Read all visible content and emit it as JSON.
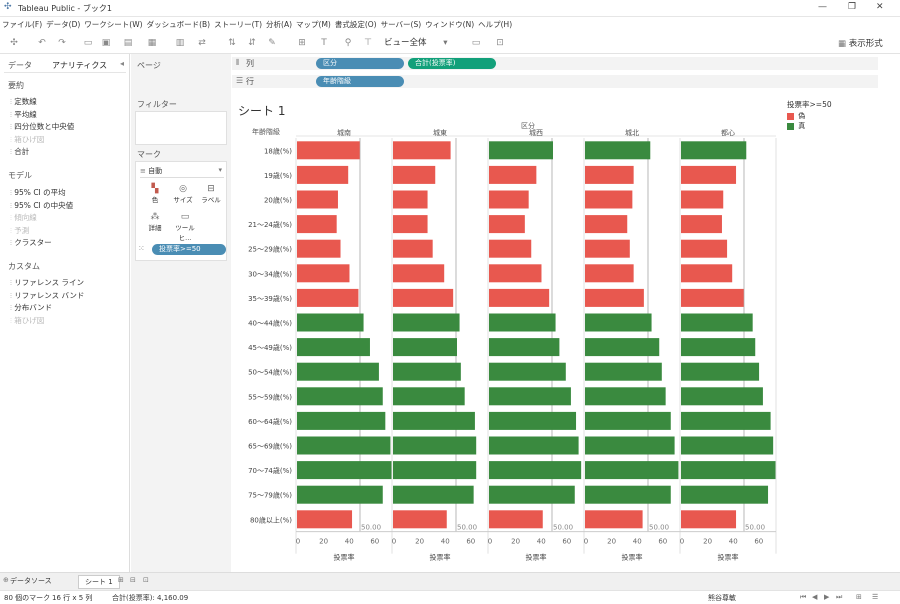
{
  "window": {
    "title": "Tableau Public - ブック1",
    "controls": [
      "—",
      "❐",
      "✕"
    ]
  },
  "menu": [
    "ファイル(F)",
    "データ(D)",
    "ワークシート(W)",
    "ダッシュボード(B)",
    "ストーリー(T)",
    "分析(A)",
    "マップ(M)",
    "書式設定(O)",
    "サーバー(S)",
    "ウィンドウ(N)",
    "ヘルプ(H)"
  ],
  "toolbar": {
    "view_fit": "ビュー全体",
    "show_me": "表示形式"
  },
  "left_panel": {
    "tab_data": "データ",
    "tab_analytics": "アナリティクス",
    "summary_title": "要約",
    "summary_items": [
      {
        "label": "定数線",
        "enabled": true
      },
      {
        "label": "平均線",
        "enabled": true
      },
      {
        "label": "四分位数と中央値",
        "enabled": true
      },
      {
        "label": "箱ひげ図",
        "enabled": false
      },
      {
        "label": "合計",
        "enabled": true
      }
    ],
    "model_title": "モデル",
    "model_items": [
      {
        "label": "95% CI の平均",
        "enabled": true
      },
      {
        "label": "95% CI の中央値",
        "enabled": true
      },
      {
        "label": "傾向線",
        "enabled": false
      },
      {
        "label": "予測",
        "enabled": false
      },
      {
        "label": "クラスター",
        "enabled": true
      }
    ],
    "custom_title": "カスタム",
    "custom_items": [
      {
        "label": "リファレンス ライン",
        "enabled": true
      },
      {
        "label": "リファレンス バンド",
        "enabled": true
      },
      {
        "label": "分布バンド",
        "enabled": true
      },
      {
        "label": "箱ひげ図",
        "enabled": false
      }
    ]
  },
  "mid_panel": {
    "pages": "ページ",
    "filters": "フィルター",
    "marks": "マーク",
    "mark_type": "自動",
    "buttons": [
      "色",
      "サイズ",
      "ラベル",
      "詳細",
      "ツールヒ..."
    ],
    "color_pill": "投票率>=50"
  },
  "shelves": {
    "columns_label": "列",
    "rows_label": "行",
    "columns_pills": [
      "区分",
      "合計(投票率)"
    ],
    "rows_pills": [
      "年齢階級"
    ]
  },
  "sheet_title": "シート 1",
  "legend": {
    "title": "投票率>=50",
    "items": [
      {
        "label": "偽",
        "color": "#e8584f"
      },
      {
        "label": "真",
        "color": "#3a8a3f"
      }
    ]
  },
  "chart_data": {
    "type": "bar",
    "orientation": "horizontal",
    "row_header": "年齢階級",
    "column_header": "区分",
    "panels": [
      "城南",
      "城東",
      "城西",
      "城北",
      "都心"
    ],
    "categories": [
      "18歳(%)",
      "19歳(%)",
      "20歳(%)",
      "21〜24歳(%)",
      "25〜29歳(%)",
      "30〜34歳(%)",
      "35〜39歳(%)",
      "40〜44歳(%)",
      "45〜49歳(%)",
      "50〜54歳(%)",
      "55〜59歳(%)",
      "60〜64歳(%)",
      "65〜69歳(%)",
      "70〜74歳(%)",
      "75〜79歳(%)",
      "80歳以上(%)"
    ],
    "series": [
      {
        "name": "城南",
        "values": [
          49,
          40,
          32,
          31,
          34,
          41,
          48,
          52,
          57,
          64,
          67,
          69,
          73,
          74,
          67,
          43
        ]
      },
      {
        "name": "城東",
        "values": [
          45,
          33,
          27,
          27,
          31,
          40,
          47,
          52,
          50,
          53,
          56,
          64,
          65,
          65,
          63,
          42
        ]
      },
      {
        "name": "城西",
        "values": [
          50,
          37,
          31,
          28,
          33,
          41,
          47,
          52,
          55,
          60,
          64,
          68,
          70,
          72,
          67,
          42
        ]
      },
      {
        "name": "城北",
        "values": [
          51,
          38,
          37,
          33,
          35,
          38,
          46,
          52,
          58,
          60,
          63,
          67,
          70,
          73,
          67,
          45
        ]
      },
      {
        "name": "都心",
        "values": [
          51,
          43,
          33,
          32,
          36,
          40,
          49,
          56,
          58,
          61,
          64,
          70,
          72,
          74,
          68,
          43
        ]
      }
    ],
    "xlim": [
      0,
      75
    ],
    "xticks": [
      0,
      20,
      40,
      60
    ],
    "xlabel": "投票率",
    "reference_line": 50,
    "reference_label": "50.00",
    "threshold": 50,
    "colors": {
      "below": "#e8584f",
      "above": "#3a8a3f"
    }
  },
  "bottom_tabs": {
    "data_source": "データソース",
    "sheet": "シート 1"
  },
  "status": {
    "marks": "80 個のマーク",
    "rows_cols": "16 行 x 5 列",
    "sum": "合計(投票率): 4,160.09",
    "user": "熊谷尊敏"
  }
}
